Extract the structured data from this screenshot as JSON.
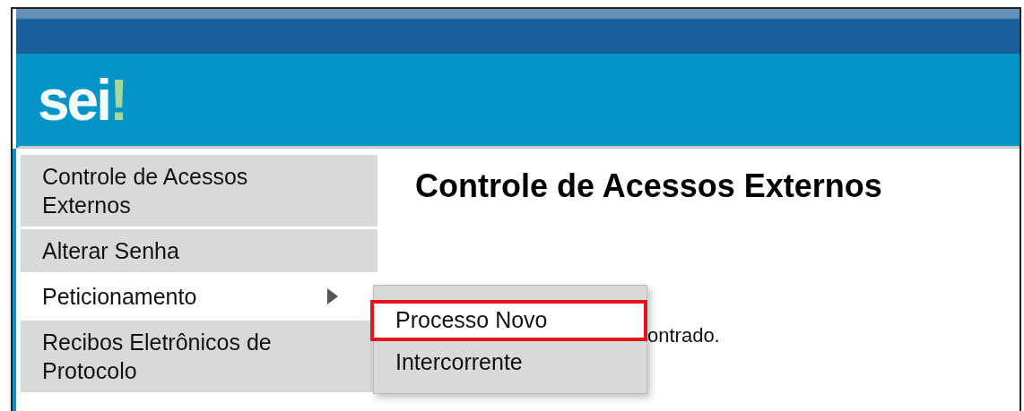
{
  "logo": {
    "text": "sei",
    "mark": "!"
  },
  "sidebar": {
    "items": [
      {
        "label": "Controle de Acessos Externos",
        "selected": false,
        "has_submenu": false
      },
      {
        "label": "Alterar Senha",
        "selected": false,
        "has_submenu": false
      },
      {
        "label": "Peticionamento",
        "selected": true,
        "has_submenu": true
      },
      {
        "label": "Recibos Eletrônicos de Protocolo",
        "selected": false,
        "has_submenu": false
      }
    ]
  },
  "submenu": {
    "items": [
      {
        "label": "Processo Novo",
        "selected": true
      },
      {
        "label": "Intercorrente",
        "selected": false
      }
    ]
  },
  "main": {
    "heading": "Controle de Acessos Externos",
    "message": "ontrado."
  }
}
